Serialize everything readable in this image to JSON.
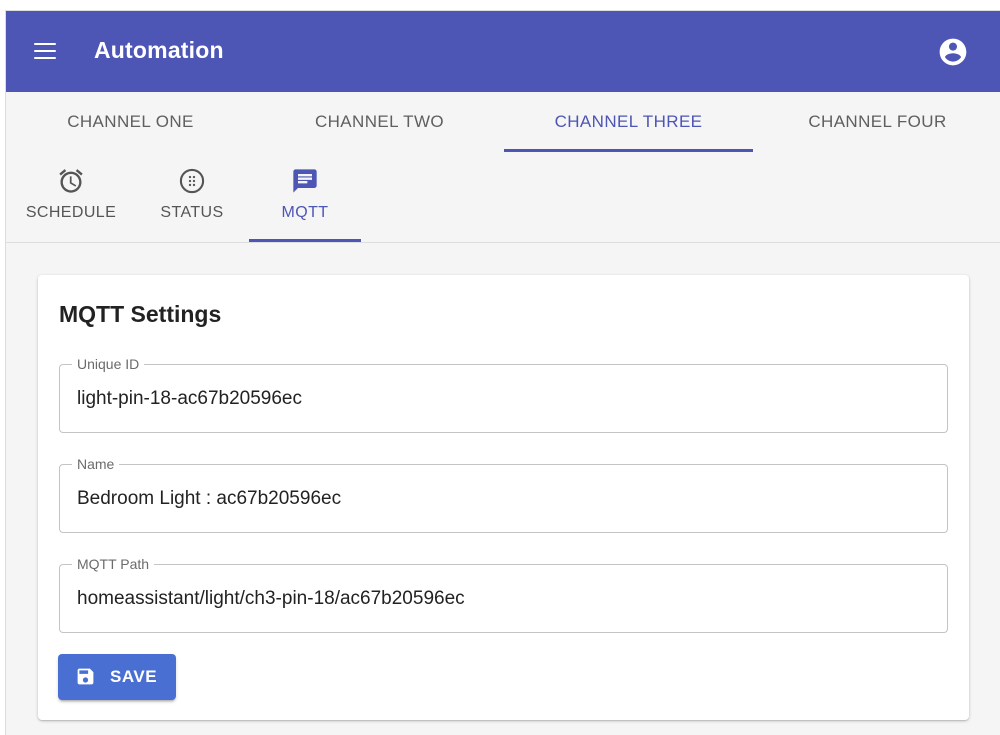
{
  "app": {
    "title": "Automation",
    "accent": "#4d55b5",
    "menu_icon": "menu-icon",
    "account_icon": "account-circle-icon"
  },
  "channel_tabs": {
    "items": [
      {
        "label": "CHANNEL ONE"
      },
      {
        "label": "CHANNEL TWO"
      },
      {
        "label": "CHANNEL THREE"
      },
      {
        "label": "CHANNEL FOUR"
      }
    ],
    "active": "CHANNEL THREE"
  },
  "sub_tabs": {
    "items": [
      {
        "label": "SCHEDULE",
        "icon": "alarm-clock-icon"
      },
      {
        "label": "STATUS",
        "icon": "status-dots-icon"
      },
      {
        "label": "MQTT",
        "icon": "message-icon"
      }
    ],
    "active": "MQTT"
  },
  "mqtt_card": {
    "title": "MQTT Settings",
    "fields": [
      {
        "label": "Unique ID",
        "value": "light-pin-18-ac67b20596ec"
      },
      {
        "label": "Name",
        "value": "Bedroom Light : ac67b20596ec"
      },
      {
        "label": "MQTT Path",
        "value": "homeassistant/light/ch3-pin-18/ac67b20596ec"
      }
    ],
    "save_label": "SAVE",
    "save_icon": "floppy-disk-icon",
    "save_color": "#4a6fd3"
  }
}
